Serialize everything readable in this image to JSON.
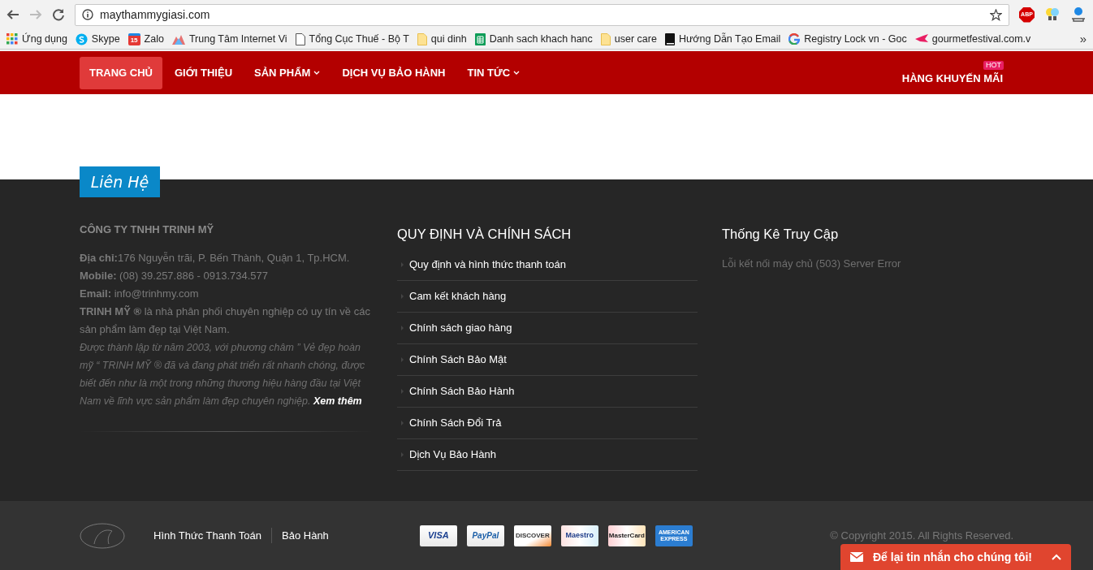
{
  "browser": {
    "url": "maythammygiasi.com",
    "bookmarks": [
      {
        "kind": "apps",
        "label": "Ứng dụng"
      },
      {
        "kind": "skype",
        "label": "Skype"
      },
      {
        "kind": "zalo",
        "label": "Zalo",
        "badge": "15"
      },
      {
        "kind": "image",
        "label": "Trung Tâm Internet Vi"
      },
      {
        "kind": "page",
        "label": "Tổng Cục Thuế - Bộ T"
      },
      {
        "kind": "folder",
        "label": "qui dinh"
      },
      {
        "kind": "sheet",
        "label": "Danh sach khach hanc"
      },
      {
        "kind": "folder",
        "label": "user care"
      },
      {
        "kind": "book",
        "label": "Hướng Dẫn Tạo Email"
      },
      {
        "kind": "google",
        "label": "Registry Lock vn - Goc"
      },
      {
        "kind": "logo",
        "label": "gourmetfestival.com.v"
      }
    ],
    "more": "»",
    "abp": "ABP"
  },
  "nav": {
    "items": [
      {
        "label": "TRANG CHỦ",
        "selected": true,
        "dropdown": false
      },
      {
        "label": "GIỚI THIỆU",
        "selected": false,
        "dropdown": false
      },
      {
        "label": "SẢN PHẨM",
        "selected": false,
        "dropdown": true
      },
      {
        "label": "DỊCH VỤ BẢO HÀNH",
        "selected": false,
        "dropdown": false
      },
      {
        "label": "TIN TỨC",
        "selected": false,
        "dropdown": true
      }
    ],
    "promo": {
      "label": "HÀNG KHUYẾN MÃI",
      "badge": "HOT"
    }
  },
  "footer": {
    "tab": "Liên Hệ",
    "company": {
      "name": "CÔNG TY TNHH TRINH MỸ",
      "lines": [
        "**Địa chỉ:**176 Nguyễn trãi, P. Bến Thành, Quận 1, Tp.HCM.",
        "**Mobile:** (08) 39.257.886 - 0913.734.577",
        "**Email:** info@trinhmy.com",
        "**TRINH MỸ ®** là nhà phân phối chuyên nghiệp có uy tín về các sản phẩm làm đẹp tại Việt Nam."
      ],
      "intro": "Được thành lập từ năm 2003, với phương châm ” Vẻ đẹp hoàn mỹ “ TRINH MỸ ® đã và đang phát triển rất nhanh chóng, được biết đến như là một trong những thương hiệu hàng đầu tại Việt Nam về lĩnh vực sản phẩm làm đẹp chuyên nghiệp.",
      "more": "Xem thêm"
    },
    "policies": {
      "title": "QUY ĐỊNH VÀ CHÍNH SÁCH",
      "items": [
        "Quy định và hình thức thanh toán",
        "Cam kết khách hàng",
        "Chính sách giao hàng",
        "Chính Sách Bảo Mật",
        "Chính Sách Bảo Hành",
        "Chính Sách Đổi Trả",
        "Dịch Vụ Bảo Hành"
      ]
    },
    "stats": {
      "title": "Thống Kê Truy Cập",
      "message": "Lỗi kết nối máy chủ (503) Server Error"
    }
  },
  "bottom": {
    "links": [
      "Hình Thức Thanh Toán",
      "Bảo Hành"
    ],
    "cards": [
      {
        "kind": "visa",
        "label": "VISA"
      },
      {
        "kind": "paypal",
        "label": "PayPal"
      },
      {
        "kind": "discover",
        "label": "DISCOVER"
      },
      {
        "kind": "maestro",
        "label": "Maestro"
      },
      {
        "kind": "mastercard",
        "label": "MasterCard"
      },
      {
        "kind": "amex",
        "label": "AMERICAN EXPRESS"
      }
    ],
    "copyright": "© Copyright 2015. All Rights Reserved.",
    "chat": "Để lại tin nhắn cho chúng tôi!"
  }
}
